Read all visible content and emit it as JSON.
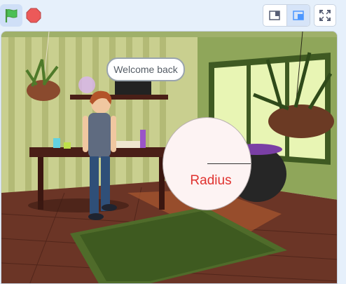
{
  "toolbar": {
    "green_flag": "green-flag-icon",
    "stop": "stop-sign-icon",
    "small_stage": "small-stage-icon",
    "large_stage": "large-stage-icon",
    "fullscreen": "fullscreen-icon"
  },
  "stage": {
    "speech_text": "Welcome back",
    "circle_label": "Radius"
  },
  "colors": {
    "flag_green": "#4cbf56",
    "stop_red": "#ec5959",
    "label_red": "#e0322f",
    "accent_blue": "#4c97ff"
  }
}
